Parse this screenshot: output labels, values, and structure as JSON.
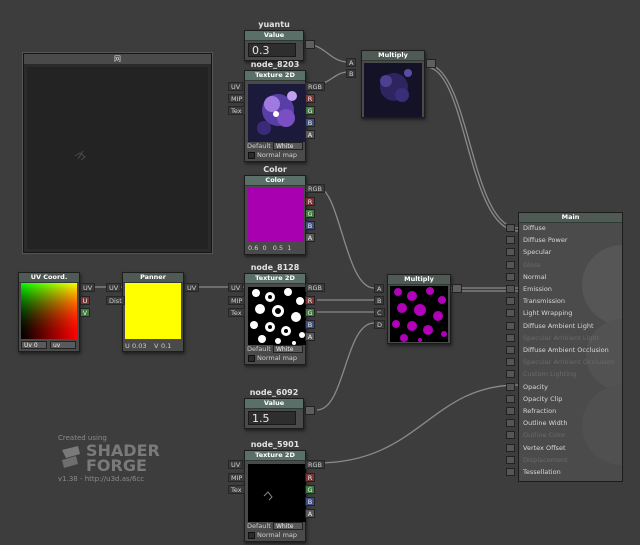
{
  "preview": {
    "title": "网"
  },
  "nodes": {
    "yuantu": {
      "name": "yuantu",
      "header": "Value",
      "value": "0.3"
    },
    "node_8203": {
      "name": "node_8203",
      "header": "Texture 2D",
      "inputs": [
        "UV",
        "MIP",
        "Tex"
      ],
      "outputs": [
        "RGB",
        "R",
        "G",
        "B",
        "A"
      ],
      "default_label": "Default",
      "default_value": "White",
      "normal_map": "Normal map"
    },
    "multiply_top": {
      "name": "Multiply",
      "inputs": [
        "A",
        "B"
      ]
    },
    "color": {
      "name": "Color",
      "header": "Color",
      "outputs": [
        "RGB",
        "R",
        "G",
        "B",
        "A"
      ],
      "values": "0.6  0   0.5  1",
      "swatch": "#a800b0"
    },
    "uv_coord": {
      "name": "UV Coord.",
      "outputs": [
        "UV",
        "U",
        "V"
      ],
      "uv_label": "Uv 0",
      "uv_value": "uv"
    },
    "panner": {
      "name": "Panner",
      "inputs": [
        "UV",
        "Dist"
      ],
      "output": "UV",
      "u_label": "U",
      "u_value": "0.03",
      "v_label": "V",
      "v_value": "0.1",
      "swatch": "#ffff00"
    },
    "node_8128": {
      "name": "node_8128",
      "header": "Texture 2D",
      "inputs": [
        "UV",
        "MIP",
        "Tex"
      ],
      "outputs": [
        "RGB",
        "R",
        "G",
        "B",
        "A"
      ],
      "default_label": "Default",
      "default_value": "White",
      "normal_map": "Normal map"
    },
    "multiply_mid": {
      "name": "Multiply",
      "inputs": [
        "A",
        "B",
        "C",
        "D"
      ]
    },
    "node_6092": {
      "name": "node_6092",
      "header": "Value",
      "value": "1.5"
    },
    "node_5901": {
      "name": "node_5901",
      "header": "Texture 2D",
      "inputs": [
        "UV",
        "MIP",
        "Tex"
      ],
      "outputs": [
        "RGB",
        "R",
        "G",
        "B",
        "A"
      ],
      "default_label": "Default",
      "default_value": "White",
      "normal_map": "Normal map"
    }
  },
  "main": {
    "title": "Main",
    "inputs": [
      {
        "label": "Diffuse",
        "enabled": true
      },
      {
        "label": "Diffuse Power",
        "enabled": true
      },
      {
        "label": "Specular",
        "enabled": true
      },
      {
        "label": "Gloss",
        "enabled": false
      },
      {
        "label": "Normal",
        "enabled": true
      },
      {
        "label": "Emission",
        "enabled": true
      },
      {
        "label": "Transmission",
        "enabled": true
      },
      {
        "label": "Light Wrapping",
        "enabled": true
      },
      {
        "label": "Diffuse Ambient Light",
        "enabled": true
      },
      {
        "label": "Specular Ambient Light",
        "enabled": false
      },
      {
        "label": "Diffuse Ambient Occlusion",
        "enabled": true
      },
      {
        "label": "Specular Ambient Occlusion",
        "enabled": false
      },
      {
        "label": "Custom Lighting",
        "enabled": false
      },
      {
        "label": "Opacity",
        "enabled": true
      },
      {
        "label": "Opacity Clip",
        "enabled": true
      },
      {
        "label": "Refraction",
        "enabled": true
      },
      {
        "label": "Outline Width",
        "enabled": true
      },
      {
        "label": "Outline Color",
        "enabled": false
      },
      {
        "label": "Vertex Offset",
        "enabled": true
      },
      {
        "label": "Displacement",
        "enabled": false
      },
      {
        "label": "Tessellation",
        "enabled": true
      }
    ]
  },
  "logo": {
    "created": "Created using",
    "shader": "SHADER",
    "forge": "FORGE",
    "version": "v1.38 - http://u3d.as/6cc"
  },
  "colors": {
    "wire": "#8a8a8a",
    "node_header": "#5a6f67",
    "magenta": "#a800b0",
    "yellow": "#ffff00"
  }
}
